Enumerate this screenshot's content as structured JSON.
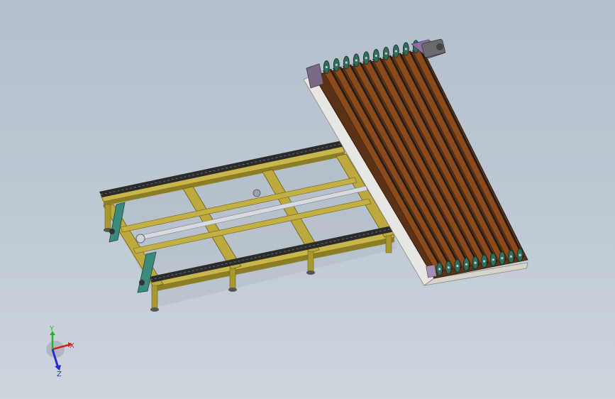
{
  "view": {
    "background_top": "#b3bfcb",
    "background_bottom": "#cdd5dd"
  },
  "model": {
    "frame_color": "#c8b64a",
    "frame_shadow": "#7d6e1f",
    "chain_color": "#2b2b2b",
    "belt_color": "#8a4a1c",
    "bracket_color": "#3c8a7a"
  },
  "triad": {
    "x_label": "X",
    "y_label": "Y",
    "z_label": "Z",
    "x_color": "#d22020",
    "y_color": "#28b428",
    "z_color": "#2030d0"
  }
}
